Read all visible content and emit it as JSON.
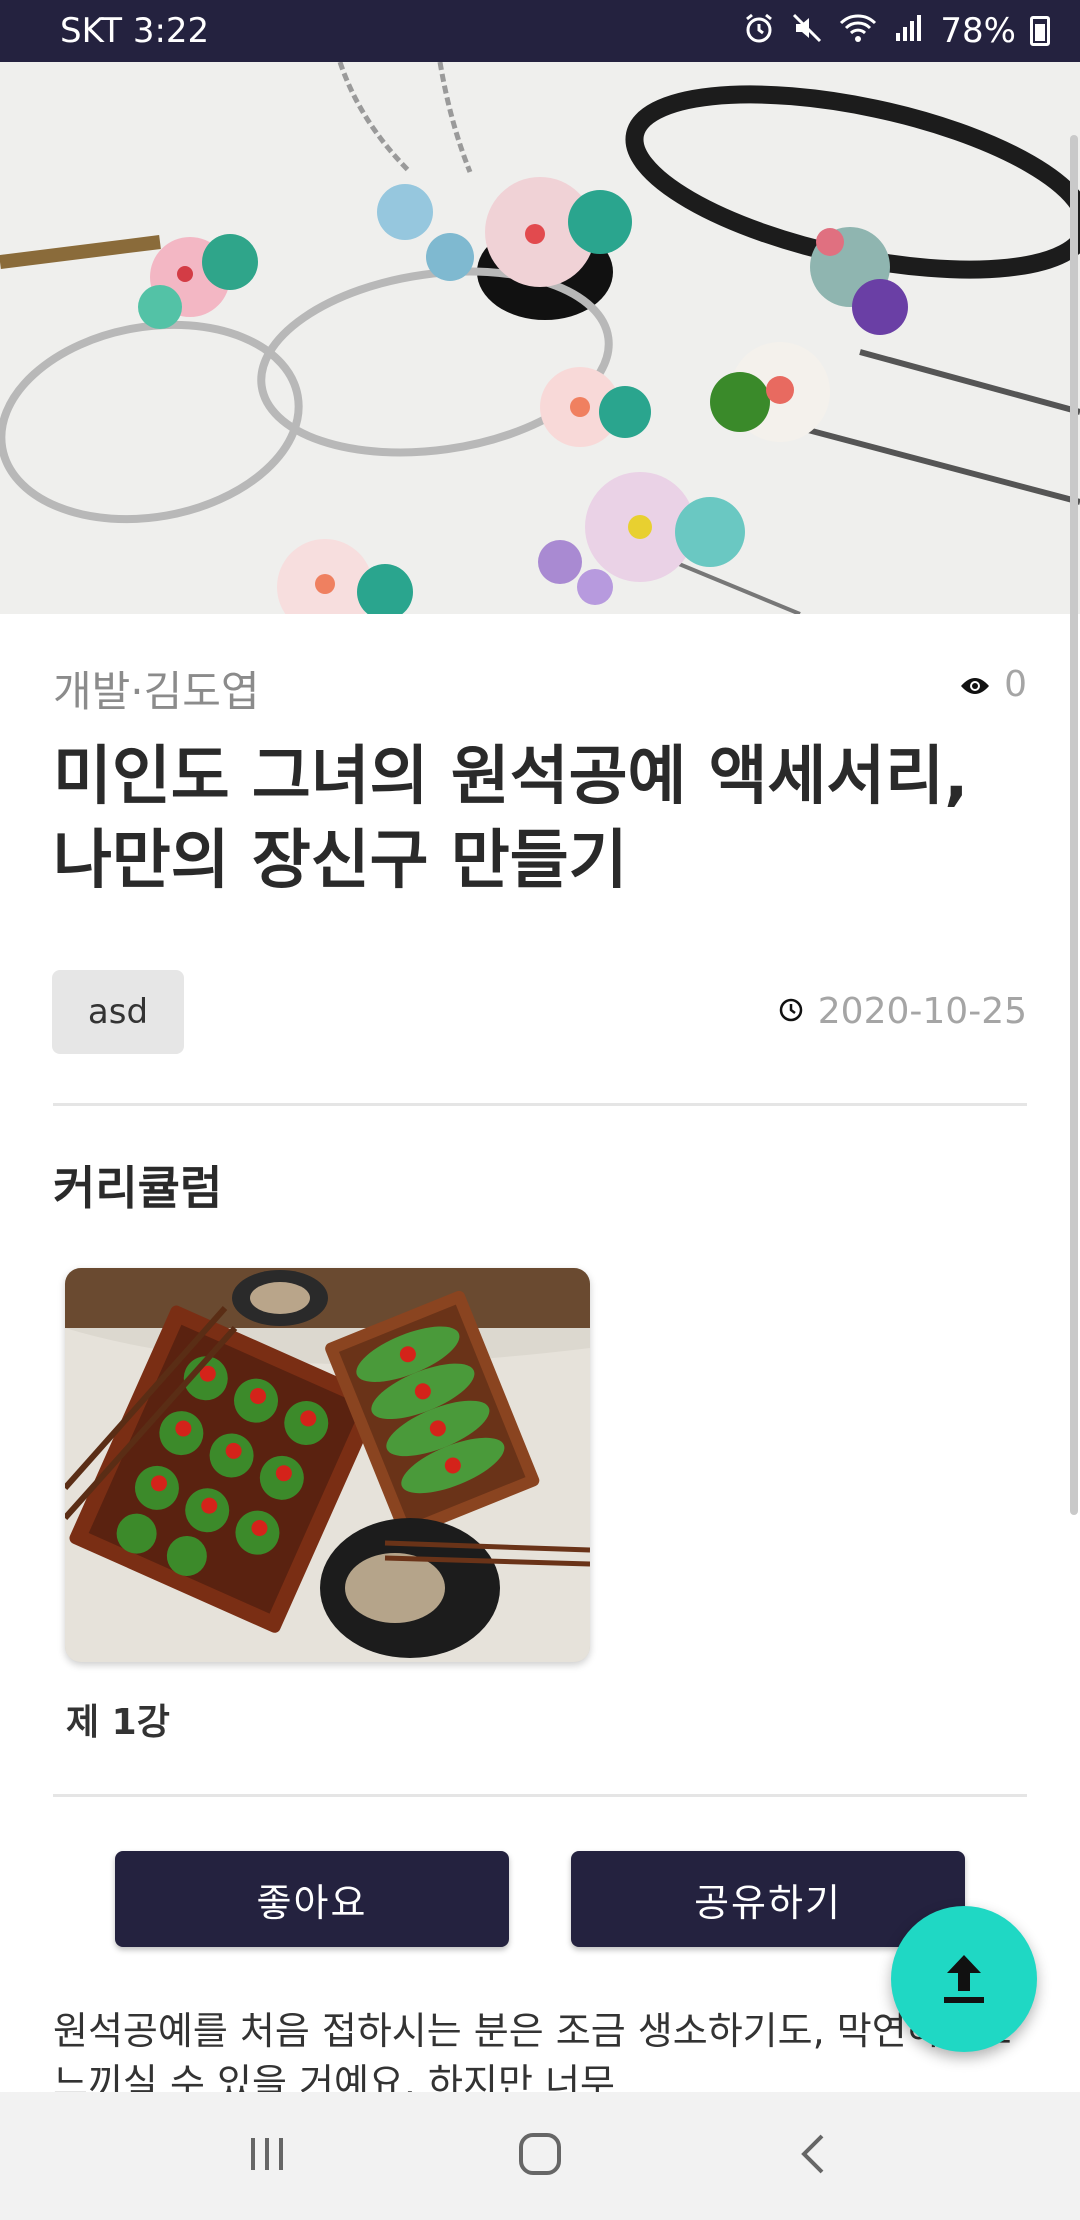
{
  "status_bar": {
    "carrier_time": "SKT 3:22",
    "battery": "78%"
  },
  "article": {
    "category": "개발·김도엽",
    "views": "0",
    "title": "미인도 그녀의 원석공예 액세서리, 나만의 장신구 만들기",
    "tag": "asd",
    "date": "2020-10-25"
  },
  "curriculum": {
    "heading": "커리큘럼",
    "items": [
      {
        "label": "제 1강"
      }
    ]
  },
  "actions": {
    "like_label": "좋아요",
    "share_label": "공유하기"
  },
  "description": "원석공예를 처음 접하시는 분은 조금 생소하기도, 막연하게도 느끼실 수 있을 거예요. 하지만 너무",
  "colors": {
    "primary": "#24223f",
    "fab": "#1fd8c4"
  }
}
